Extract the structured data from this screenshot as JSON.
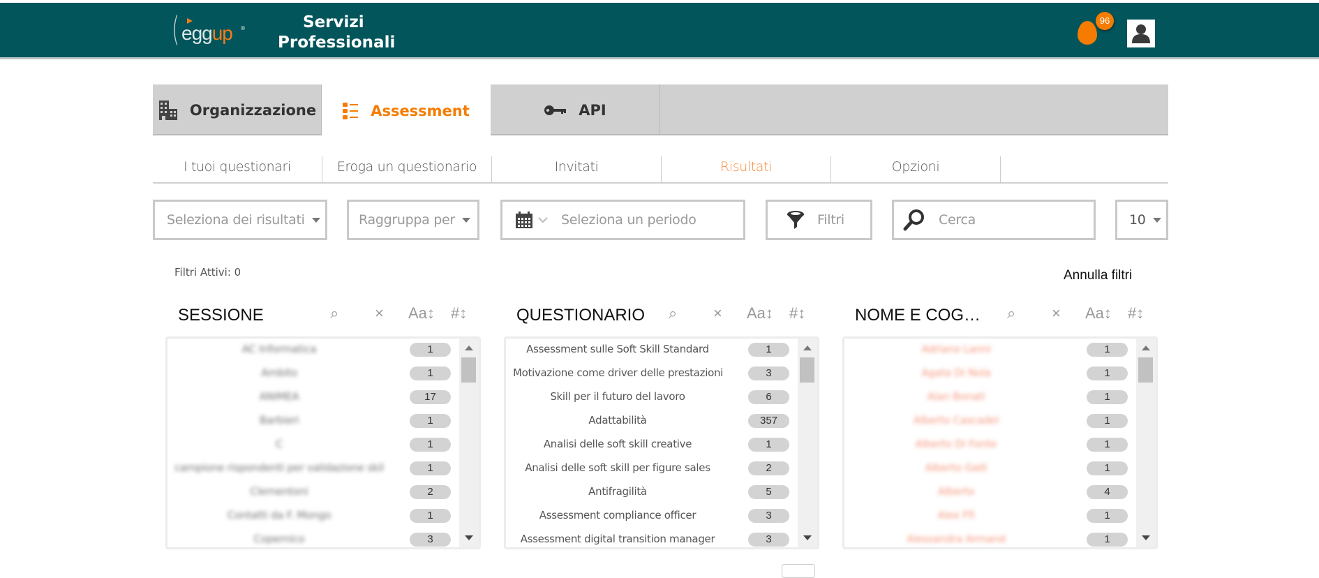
{
  "header": {
    "logo_text_main": "egg",
    "logo_text_accent": "up",
    "logo_registered": "®",
    "title_line1": "Servizi",
    "title_line2": "Professionali",
    "notification_count": "96",
    "colors": {
      "bar": "#02555A",
      "accent": "#F57C00"
    }
  },
  "main_tabs": [
    {
      "label": "Organizzazione",
      "icon": "building-icon",
      "active": false
    },
    {
      "label": "Assessment",
      "icon": "list-icon",
      "active": true
    },
    {
      "label": "API",
      "icon": "key-icon",
      "active": false
    }
  ],
  "sub_tabs": [
    {
      "label": "I tuoi questionari",
      "active": false
    },
    {
      "label": "Eroga un questionario",
      "active": false
    },
    {
      "label": "Invitati",
      "active": false
    },
    {
      "label": "Risultati",
      "active": true
    },
    {
      "label": "Opzioni",
      "active": false
    }
  ],
  "controls": {
    "select_results_placeholder": "Seleziona dei risultati",
    "group_by_placeholder": "Raggruppa per",
    "period_placeholder": "Seleziona un periodo",
    "filters_label": "Filtri",
    "search_placeholder": "Cerca",
    "page_size": "10"
  },
  "filters": {
    "active_label": "Filtri Attivi: 0",
    "clear_label": "Annulla filtri"
  },
  "panels": [
    {
      "title": "SESSIONE",
      "blurred": true,
      "rows": [
        {
          "name": "AC Informatica",
          "count": "1"
        },
        {
          "name": "Ambito",
          "count": "1"
        },
        {
          "name": "ANIMEA",
          "count": "17"
        },
        {
          "name": "Barbieri",
          "count": "1"
        },
        {
          "name": "C",
          "count": "1"
        },
        {
          "name": "campione rispondenti per validazione skill n…",
          "count": "1"
        },
        {
          "name": "Clementoni",
          "count": "2"
        },
        {
          "name": "Contatti da F. Mongo",
          "count": "1"
        },
        {
          "name": "Copernico",
          "count": "3"
        }
      ]
    },
    {
      "title": "QUESTIONARIO",
      "blurred": false,
      "rows": [
        {
          "name": "Assessment sulle Soft Skill Standard",
          "count": "1"
        },
        {
          "name": "Motivazione come driver delle prestazioni",
          "count": "3"
        },
        {
          "name": "Skill per il futuro del lavoro",
          "count": "6"
        },
        {
          "name": "Adattabilità",
          "count": "357"
        },
        {
          "name": "Analisi delle soft skill creative",
          "count": "1"
        },
        {
          "name": "Analisi delle soft skill per figure sales",
          "count": "2"
        },
        {
          "name": "Antifragilità",
          "count": "5"
        },
        {
          "name": "Assessment compliance officer",
          "count": "3"
        },
        {
          "name": "Assessment digital transition manager",
          "count": "3"
        }
      ]
    },
    {
      "title": "NOME E COG…",
      "blurred": true,
      "rows": [
        {
          "name": "Adriano Lanni",
          "count": "1"
        },
        {
          "name": "Agata Di Nola",
          "count": "1"
        },
        {
          "name": "Alan Bonati",
          "count": "1"
        },
        {
          "name": "Alberto Cascadel",
          "count": "1"
        },
        {
          "name": "Alberto Di Fonte",
          "count": "1"
        },
        {
          "name": "Alberto Galli",
          "count": "1"
        },
        {
          "name": "Alberto",
          "count": "4"
        },
        {
          "name": "Alex Ffi",
          "count": "1"
        },
        {
          "name": "Alessandra Armand",
          "count": "1"
        }
      ]
    }
  ],
  "panel_tools": {
    "search_icon": "⌕",
    "clear_icon": "×",
    "sort_alpha_label": "Aa↕",
    "sort_num_label": "#↕"
  }
}
